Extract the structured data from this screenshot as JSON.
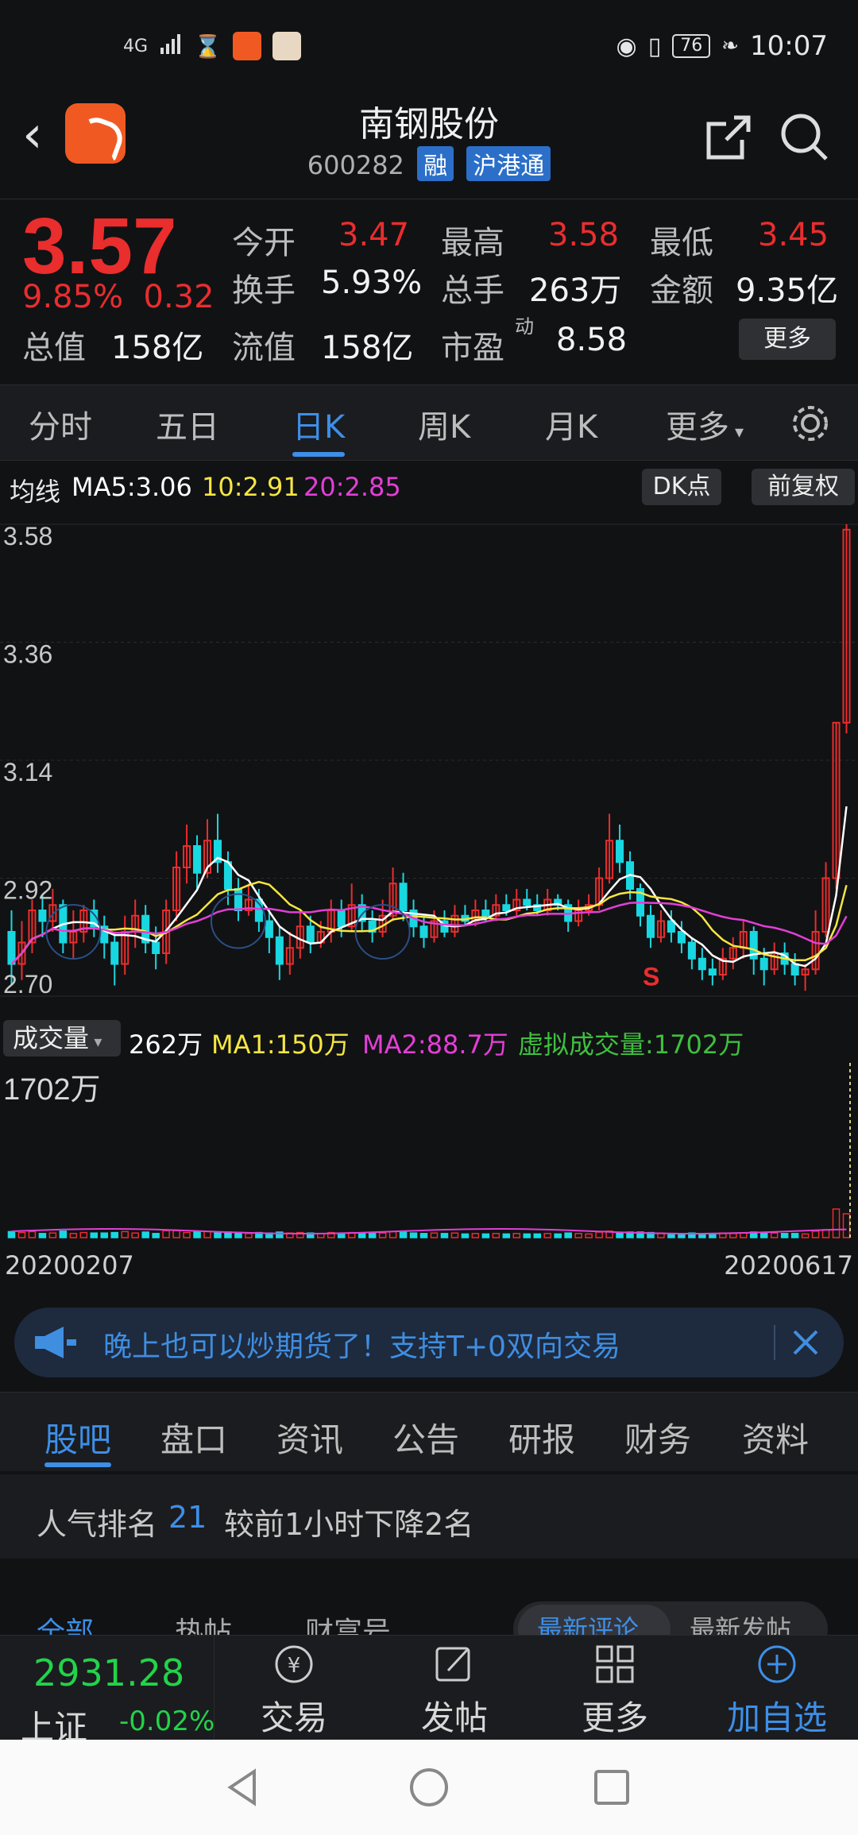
{
  "status": {
    "network": "4G",
    "battery": "76",
    "time": "10:07"
  },
  "header": {
    "stock_name": "南钢股份",
    "stock_code": "600282",
    "tags": [
      "融",
      "沪港通"
    ]
  },
  "quote": {
    "price": "3.57",
    "change_pct": "9.85%",
    "change": "0.32",
    "open_label": "今开",
    "open": "3.47",
    "high_label": "最高",
    "high": "3.58",
    "low_label": "最低",
    "low": "3.45",
    "turnover_label": "换手",
    "turnover": "5.93%",
    "volume_label": "总手",
    "volume": "263万",
    "amount_label": "金额",
    "amount": "9.35亿",
    "mktcap_label": "总值",
    "mktcap": "158亿",
    "float_label": "流值",
    "float": "158亿",
    "pe_label": "市盈",
    "pe_sup": "动",
    "pe": "8.58",
    "more_label": "更多"
  },
  "period_tabs": [
    "分时",
    "五日",
    "日K",
    "周K",
    "月K",
    "更多"
  ],
  "period_active": 2,
  "ma": {
    "label": "均线",
    "ma5": "MA5:3.06",
    "ma10": "10:2.91",
    "ma20": "20:2.85",
    "dk_label": "DK点",
    "adjust_label": "前复权"
  },
  "volume_info": {
    "selector": "成交量",
    "current": "262万",
    "ma1": "MA1:150万",
    "ma2": "MA2:88.7万",
    "virtual": "虚拟成交量:1702万",
    "axis_max": "1702万"
  },
  "dates": {
    "start": "20200207",
    "end": "20200617"
  },
  "ad": {
    "text": "晚上也可以炒期货了！支持T+0双向交易"
  },
  "content_tabs": [
    "股吧",
    "盘口",
    "资讯",
    "公告",
    "研报",
    "财务",
    "资料"
  ],
  "content_active": 0,
  "rank": {
    "prefix": "人气排名",
    "number": "21",
    "suffix": "较前1小时下降2名"
  },
  "sub_tabs": {
    "left": [
      "全部",
      "热帖",
      "财富号"
    ],
    "right": [
      "最新评论",
      "最新发帖"
    ]
  },
  "bottom": {
    "index_value": "2931.28",
    "index_name": "上证",
    "index_change": "-0.02%",
    "items": [
      "交易",
      "发帖",
      "更多",
      "加自选"
    ]
  },
  "colors": {
    "up": "#ea2d2d",
    "down": "#19d7e0",
    "accent": "#3d8fe8",
    "ma5": "#ffffff",
    "ma10": "#f5e642",
    "ma20": "#e23fd6"
  },
  "chart_data": {
    "type": "candlestick",
    "title": "",
    "x_range": [
      "20200207",
      "20200617"
    ],
    "ylim": [
      2.7,
      3.58
    ],
    "y_ticks": [
      3.58,
      3.36,
      3.14,
      2.92,
      2.7
    ],
    "series": [
      {
        "name": "MA5",
        "value": 3.06
      },
      {
        "name": "MA10",
        "value": 2.91
      },
      {
        "name": "MA20",
        "value": 2.85
      }
    ],
    "candles": [
      [
        2.82,
        2.76,
        2.86,
        2.72
      ],
      [
        2.76,
        2.8,
        2.84,
        2.73
      ],
      [
        2.8,
        2.86,
        2.88,
        2.78
      ],
      [
        2.86,
        2.84,
        2.89,
        2.81
      ],
      [
        2.84,
        2.87,
        2.9,
        2.82
      ],
      [
        2.87,
        2.8,
        2.88,
        2.78
      ],
      [
        2.8,
        2.82,
        2.86,
        2.77
      ],
      [
        2.82,
        2.86,
        2.87,
        2.8
      ],
      [
        2.86,
        2.83,
        2.88,
        2.81
      ],
      [
        2.83,
        2.8,
        2.85,
        2.77
      ],
      [
        2.8,
        2.76,
        2.82,
        2.72
      ],
      [
        2.76,
        2.82,
        2.85,
        2.74
      ],
      [
        2.82,
        2.85,
        2.88,
        2.79
      ],
      [
        2.85,
        2.8,
        2.87,
        2.78
      ],
      [
        2.8,
        2.78,
        2.83,
        2.75
      ],
      [
        2.78,
        2.86,
        2.88,
        2.76
      ],
      [
        2.86,
        2.94,
        2.97,
        2.84
      ],
      [
        2.94,
        2.98,
        3.02,
        2.91
      ],
      [
        2.98,
        2.93,
        3.0,
        2.9
      ],
      [
        2.93,
        2.99,
        3.03,
        2.92
      ],
      [
        2.99,
        2.95,
        3.04,
        2.93
      ],
      [
        2.95,
        2.9,
        2.97,
        2.87
      ],
      [
        2.9,
        2.86,
        2.92,
        2.84
      ],
      [
        2.86,
        2.88,
        2.91,
        2.85
      ],
      [
        2.88,
        2.84,
        2.9,
        2.82
      ],
      [
        2.84,
        2.81,
        2.86,
        2.78
      ],
      [
        2.81,
        2.76,
        2.83,
        2.73
      ],
      [
        2.76,
        2.79,
        2.82,
        2.74
      ],
      [
        2.79,
        2.83,
        2.86,
        2.77
      ],
      [
        2.83,
        2.8,
        2.85,
        2.78
      ],
      [
        2.8,
        2.82,
        2.84,
        2.79
      ],
      [
        2.82,
        2.86,
        2.88,
        2.8
      ],
      [
        2.86,
        2.83,
        2.88,
        2.81
      ],
      [
        2.83,
        2.87,
        2.91,
        2.82
      ],
      [
        2.87,
        2.84,
        2.89,
        2.82
      ],
      [
        2.84,
        2.82,
        2.86,
        2.8
      ],
      [
        2.82,
        2.85,
        2.88,
        2.81
      ],
      [
        2.85,
        2.91,
        2.94,
        2.84
      ],
      [
        2.91,
        2.86,
        2.93,
        2.84
      ],
      [
        2.86,
        2.83,
        2.88,
        2.81
      ],
      [
        2.83,
        2.81,
        2.85,
        2.79
      ],
      [
        2.81,
        2.84,
        2.86,
        2.8
      ],
      [
        2.84,
        2.82,
        2.86,
        2.81
      ],
      [
        2.82,
        2.85,
        2.87,
        2.81
      ],
      [
        2.85,
        2.84,
        2.87,
        2.83
      ],
      [
        2.84,
        2.86,
        2.88,
        2.83
      ],
      [
        2.86,
        2.85,
        2.88,
        2.84
      ],
      [
        2.85,
        2.87,
        2.89,
        2.84
      ],
      [
        2.87,
        2.86,
        2.89,
        2.85
      ],
      [
        2.86,
        2.88,
        2.9,
        2.85
      ],
      [
        2.88,
        2.87,
        2.9,
        2.86
      ],
      [
        2.87,
        2.86,
        2.89,
        2.85
      ],
      [
        2.86,
        2.88,
        2.9,
        2.85
      ],
      [
        2.88,
        2.87,
        2.89,
        2.86
      ],
      [
        2.87,
        2.84,
        2.88,
        2.82
      ],
      [
        2.84,
        2.86,
        2.88,
        2.83
      ],
      [
        2.86,
        2.87,
        2.89,
        2.85
      ],
      [
        2.87,
        2.92,
        2.94,
        2.86
      ],
      [
        2.92,
        2.99,
        3.04,
        2.91
      ],
      [
        2.99,
        2.95,
        3.02,
        2.93
      ],
      [
        2.95,
        2.9,
        2.97,
        2.88
      ],
      [
        2.9,
        2.85,
        2.91,
        2.83
      ],
      [
        2.85,
        2.81,
        2.87,
        2.79
      ],
      [
        2.81,
        2.84,
        2.86,
        2.8
      ],
      [
        2.84,
        2.82,
        2.86,
        2.8
      ],
      [
        2.82,
        2.8,
        2.84,
        2.78
      ],
      [
        2.8,
        2.77,
        2.81,
        2.75
      ],
      [
        2.77,
        2.75,
        2.79,
        2.73
      ],
      [
        2.75,
        2.74,
        2.77,
        2.72
      ],
      [
        2.74,
        2.77,
        2.79,
        2.73
      ],
      [
        2.77,
        2.79,
        2.81,
        2.75
      ],
      [
        2.79,
        2.82,
        2.84,
        2.77
      ],
      [
        2.82,
        2.77,
        2.83,
        2.74
      ],
      [
        2.77,
        2.75,
        2.79,
        2.72
      ],
      [
        2.75,
        2.78,
        2.8,
        2.74
      ],
      [
        2.78,
        2.76,
        2.8,
        2.74
      ],
      [
        2.76,
        2.74,
        2.78,
        2.72
      ],
      [
        2.74,
        2.75,
        2.76,
        2.71
      ],
      [
        2.75,
        2.82,
        2.86,
        2.74
      ],
      [
        2.82,
        2.92,
        2.95,
        2.81
      ],
      [
        2.92,
        3.21,
        3.21,
        2.9
      ],
      [
        3.21,
        3.57,
        3.58,
        3.19
      ]
    ]
  }
}
